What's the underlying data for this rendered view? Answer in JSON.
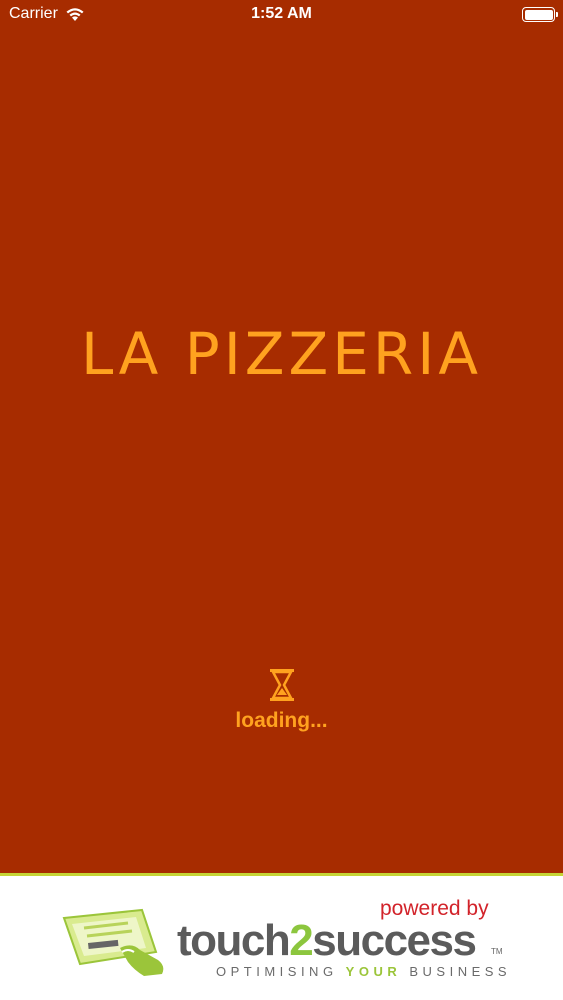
{
  "status_bar": {
    "carrier": "Carrier",
    "time": "1:52 AM",
    "wifi_icon": "wifi-icon",
    "battery_icon": "battery-icon"
  },
  "splash": {
    "title": "LA PIZZERIA",
    "loading_text": "loading...",
    "loading_icon": "hourglass-icon"
  },
  "footer": {
    "powered_by": "powered by",
    "brand_part1": "touch",
    "brand_part2": "2",
    "brand_part3": "success",
    "trademark": "TM",
    "tagline_start": "OPTIMISING ",
    "tagline_highlight": "YOUR",
    "tagline_end": " BUSINESS"
  },
  "colors": {
    "background": "#a72c00",
    "accent": "#ffa21f",
    "powered_red": "#d2232a",
    "brand_green": "#8cc63e"
  }
}
